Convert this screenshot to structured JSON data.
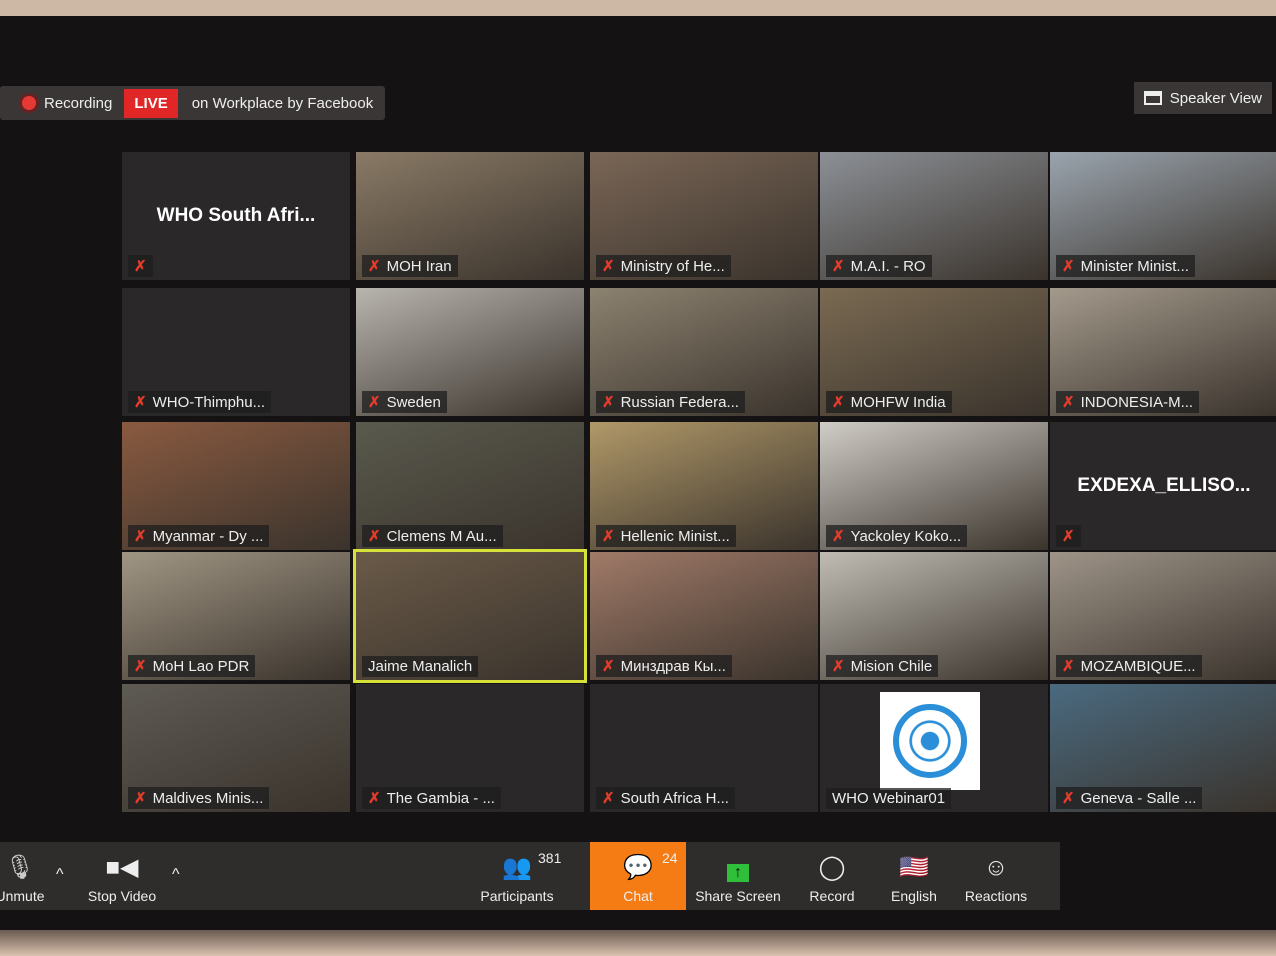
{
  "topbar": {
    "recording": "Recording",
    "live": "LIVE",
    "live_target": "on Workplace by Facebook",
    "speaker_view": "Speaker View"
  },
  "tiles": [
    {
      "name": "WHO South Afri...",
      "video": false,
      "big": true,
      "muted": true
    },
    {
      "name": "MOH Iran",
      "video": true,
      "bg": "#8a7a66",
      "muted": true
    },
    {
      "name": "Ministry of He...",
      "video": true,
      "bg": "#7a6656",
      "muted": true
    },
    {
      "name": "M.A.I. - RO",
      "video": true,
      "bg": "#8c9096",
      "muted": true
    },
    {
      "name": "Minister Minist...",
      "video": true,
      "bg": "#9aa4ae",
      "muted": true
    },
    {
      "name": "WHO-Thimphu...",
      "video": false,
      "muted": true
    },
    {
      "name": "Sweden",
      "video": true,
      "bg": "#b8b4ae",
      "muted": true
    },
    {
      "name": "Russian Federa...",
      "video": true,
      "bg": "#8c8270",
      "muted": true
    },
    {
      "name": "MOHFW India",
      "video": true,
      "bg": "#7a6a52",
      "muted": true
    },
    {
      "name": "INDONESIA-M...",
      "video": true,
      "bg": "#a49a8c",
      "muted": true
    },
    {
      "name": "Myanmar - Dy ...",
      "video": true,
      "bg": "#8a5a40",
      "muted": true
    },
    {
      "name": "Clemens M Au...",
      "video": true,
      "bg": "#5a5a4e",
      "muted": true
    },
    {
      "name": "Hellenic Minist...",
      "video": true,
      "bg": "#b09868",
      "muted": true
    },
    {
      "name": "Yackoley Koko...",
      "video": true,
      "bg": "#d0ccc6",
      "muted": true
    },
    {
      "name": "EXDEXA_ELLISO...",
      "video": false,
      "big": true,
      "muted": true
    },
    {
      "name": "MoH Lao PDR",
      "video": true,
      "bg": "#a09684",
      "muted": true
    },
    {
      "name": "Jaime Manalich",
      "video": true,
      "bg": "#6a5a48",
      "muted": false,
      "speaking": true
    },
    {
      "name": "Минздрав Кы...",
      "video": true,
      "bg": "#a07a68",
      "muted": true
    },
    {
      "name": "Mision Chile",
      "video": true,
      "bg": "#c0bcb4",
      "muted": true
    },
    {
      "name": "MOZAMBIQUE...",
      "video": true,
      "bg": "#9e9488",
      "muted": true
    },
    {
      "name": "Maldives Minis...",
      "video": true,
      "bg": "#5e5a54",
      "muted": true
    },
    {
      "name": "The Gambia - ...",
      "video": false,
      "muted": true
    },
    {
      "name": "South Africa H...",
      "video": false,
      "muted": true
    },
    {
      "name": "WHO Webinar01",
      "video": false,
      "logo": true,
      "muted": false
    },
    {
      "name": "Geneva - Salle ...",
      "video": true,
      "bg": "#4a6a80",
      "muted": true
    }
  ],
  "toolbar": {
    "unmute": "Unmute",
    "stop_video": "Stop Video",
    "participants": "Participants",
    "participants_count": "381",
    "chat": "Chat",
    "chat_count": "24",
    "share_screen": "Share Screen",
    "record": "Record",
    "language": "English",
    "reactions": "Reactions"
  },
  "colors": {
    "live": "#e02626",
    "chat": "#f57c14",
    "share": "#2fbf3a",
    "speaking": "#d6e23a",
    "muted": "#e43b2b"
  }
}
